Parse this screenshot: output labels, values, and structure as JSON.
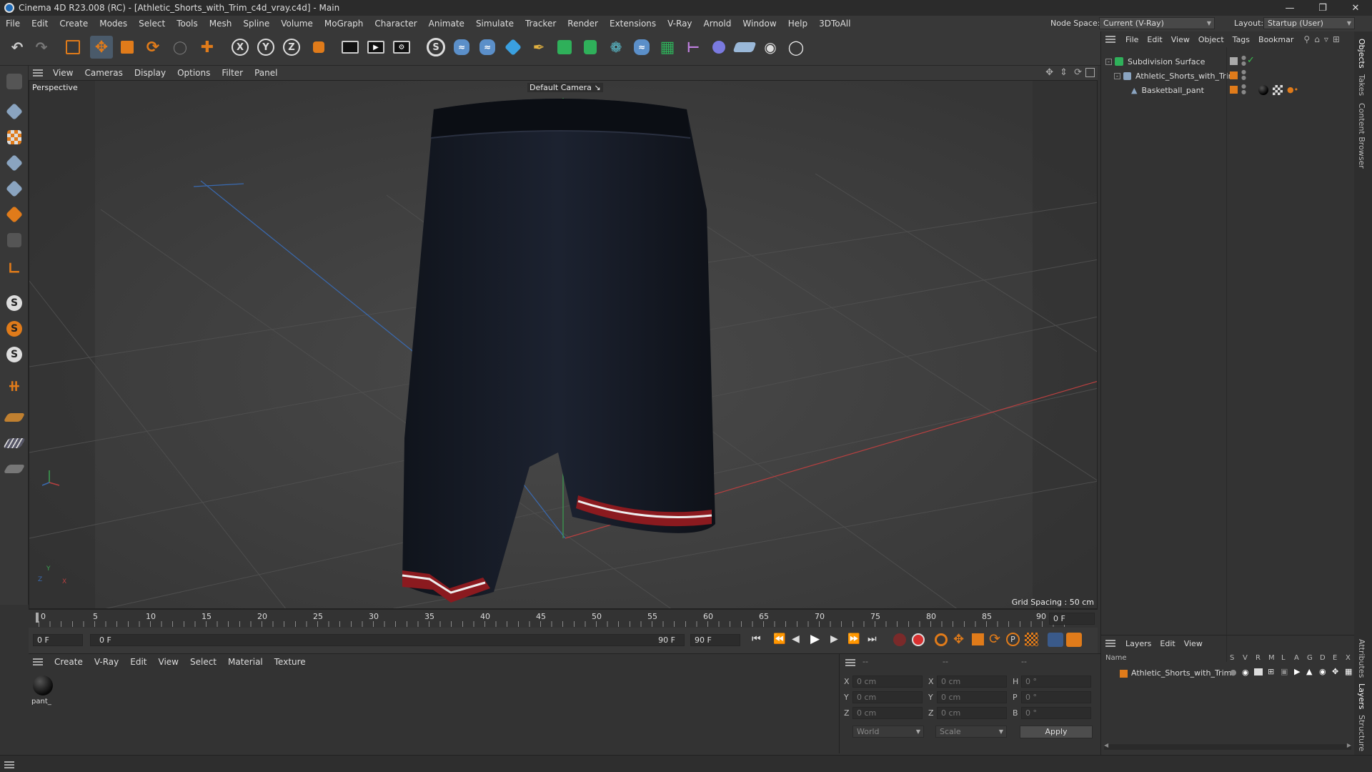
{
  "window": {
    "title": "Cinema 4D R23.008 (RC) - [Athletic_Shorts_with_Trim_c4d_vray.c4d] - Main",
    "min_icon": "minimize-icon",
    "max_icon": "restore-icon",
    "close_icon": "close-icon"
  },
  "menubar": {
    "items": [
      "File",
      "Edit",
      "Create",
      "Modes",
      "Select",
      "Tools",
      "Mesh",
      "Spline",
      "Volume",
      "MoGraph",
      "Character",
      "Animate",
      "Simulate",
      "Tracker",
      "Render",
      "Extensions",
      "V-Ray",
      "Arnold",
      "Window",
      "Help",
      "3DToAll"
    ],
    "node_space_label": "Node Space:",
    "node_space_value": "Current (V-Ray)",
    "layout_label": "Layout:",
    "layout_value": "Startup (User)"
  },
  "viewport": {
    "menu": [
      "View",
      "Cameras",
      "Display",
      "Options",
      "Filter",
      "Panel"
    ],
    "name": "Perspective",
    "camera": "Default Camera",
    "grid_spacing": "Grid Spacing : 50 cm",
    "axis_y": "Y",
    "axis_x": "X",
    "axis_z": "Z"
  },
  "timeline": {
    "ticks": [
      "0",
      "5",
      "10",
      "15",
      "20",
      "25",
      "30",
      "35",
      "40",
      "45",
      "50",
      "55",
      "60",
      "65",
      "70",
      "75",
      "80",
      "85",
      "90"
    ],
    "current_frame": "0 F",
    "start_field": "0 F",
    "range_start": "0 F",
    "range_end": "90 F",
    "end_field": "90 F"
  },
  "material_manager": {
    "menu": [
      "Create",
      "V-Ray",
      "Edit",
      "View",
      "Select",
      "Material",
      "Texture"
    ],
    "materials": [
      {
        "name": "pant_"
      }
    ]
  },
  "coord_manager": {
    "header": [
      "--",
      "--",
      "--"
    ],
    "rows": [
      {
        "l1": "X",
        "v1": "0 cm",
        "l2": "X",
        "v2": "0 cm",
        "l3": "H",
        "v3": "0 °"
      },
      {
        "l1": "Y",
        "v1": "0 cm",
        "l2": "Y",
        "v2": "0 cm",
        "l3": "P",
        "v3": "0 °"
      },
      {
        "l1": "Z",
        "v1": "0 cm",
        "l2": "Z",
        "v2": "0 cm",
        "l3": "B",
        "v3": "0 °"
      }
    ],
    "world": "World",
    "scale": "Scale",
    "apply": "Apply"
  },
  "object_manager": {
    "menu": [
      "File",
      "Edit",
      "View",
      "Object",
      "Tags",
      "Bookmar"
    ],
    "objects": [
      {
        "name": "Subdivision Surface"
      },
      {
        "name": "Athletic_Shorts_with_Trim"
      },
      {
        "name": "Basketball_pant"
      }
    ]
  },
  "layer_manager": {
    "menu": [
      "Layers",
      "Edit",
      "View"
    ],
    "col_name": "Name",
    "cols": [
      "S",
      "V",
      "R",
      "M",
      "L",
      "A",
      "G",
      "D",
      "E",
      "X"
    ],
    "layers": [
      {
        "name": "Athletic_Shorts_with_Trim"
      }
    ]
  },
  "side_tabs": [
    "Objects",
    "Takes",
    "Content Browser",
    "Attributes",
    "Layers",
    "Structure"
  ],
  "colors": {
    "accent_orange": "#e07b1a",
    "bg": "#333333",
    "viewport_bg": "#3c3c3c"
  }
}
